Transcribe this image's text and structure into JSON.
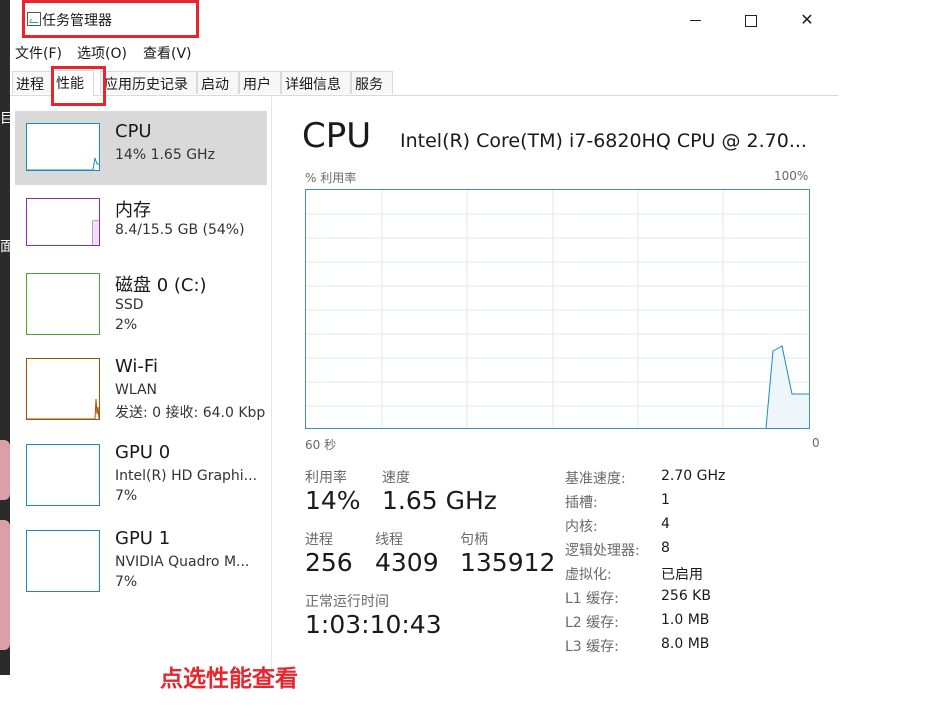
{
  "window": {
    "title": "任务管理器",
    "controls": {
      "minimize": "—",
      "maximize": "☐",
      "close": "✕"
    }
  },
  "menu": [
    "文件(F)",
    "选项(O)",
    "查看(V)"
  ],
  "tabs": [
    "进程",
    "性能",
    "应用历史记录",
    "启动",
    "用户",
    "详细信息",
    "服务"
  ],
  "active_tab": "性能",
  "sidebar": [
    {
      "name": "CPU",
      "line1": "14% 1.65 GHz",
      "line2": "",
      "color": "#1c8ac0"
    },
    {
      "name": "内存",
      "line1": "8.4/15.5 GB (54%)",
      "line2": "",
      "color": "#8b2bb0"
    },
    {
      "name": "磁盘 0 (C:)",
      "line1": "SSD",
      "line2": "2%",
      "color": "#4da72e"
    },
    {
      "name": "Wi-Fi",
      "line1": "WLAN",
      "line2": "发送: 0 接收: 64.0 Kbp",
      "color": "#a74f01"
    },
    {
      "name": "GPU 0",
      "line1": "Intel(R) HD Graphi...",
      "line2": "7%",
      "color": "#1c8ac0"
    },
    {
      "name": "GPU 1",
      "line1": "NVIDIA Quadro M...",
      "line2": "7%",
      "color": "#1c8ac0"
    }
  ],
  "main": {
    "title": "CPU",
    "model": "Intel(R) Core(TM) i7-6820HQ CPU @ 2.70...",
    "graph": {
      "y_label": "% 利用率",
      "y_max": "100%",
      "x_left": "60 秒",
      "x_right": "0",
      "line_color": "#1c8ac0",
      "grid_color": "#dbeaf3"
    },
    "stats": {
      "utilization_label": "利用率",
      "utilization": "14%",
      "speed_label": "速度",
      "speed": "1.65 GHz",
      "processes_label": "进程",
      "processes": "256",
      "threads_label": "线程",
      "threads": "4309",
      "handles_label": "句柄",
      "handles": "135912",
      "uptime_label": "正常运行时间",
      "uptime": "1:03:10:43"
    },
    "specs": [
      {
        "label": "基准速度:",
        "value": "2.70 GHz"
      },
      {
        "label": "插槽:",
        "value": "1"
      },
      {
        "label": "内核:",
        "value": "4"
      },
      {
        "label": "逻辑处理器:",
        "value": "8"
      },
      {
        "label": "虚拟化:",
        "value": "已启用"
      },
      {
        "label": "L1 缓存:",
        "value": "256 KB"
      },
      {
        "label": "L2 缓存:",
        "value": "1.0 MB"
      },
      {
        "label": "L3 缓存:",
        "value": "8.0 MB"
      }
    ]
  },
  "annotation": {
    "text": "点选性能查看",
    "color": "#e8242d"
  },
  "desktop_glyphs": [
    "目",
    "面"
  ]
}
